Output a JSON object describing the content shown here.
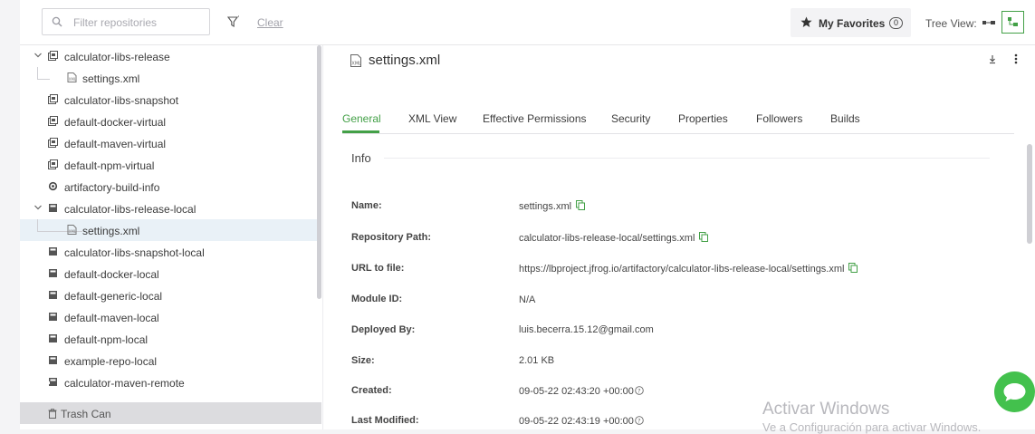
{
  "toolbar": {
    "filter_placeholder": "Filter repositories",
    "clear_label": "Clear",
    "favorites_label": "My Favorites",
    "favorites_count": "0",
    "tree_view_label": "Tree View:"
  },
  "tree": {
    "items": [
      {
        "label": "calculator-libs-release"
      },
      {
        "label": "settings.xml"
      },
      {
        "label": "calculator-libs-snapshot"
      },
      {
        "label": "default-docker-virtual"
      },
      {
        "label": "default-maven-virtual"
      },
      {
        "label": "default-npm-virtual"
      },
      {
        "label": "artifactory-build-info"
      },
      {
        "label": "calculator-libs-release-local"
      },
      {
        "label": "settings.xml"
      },
      {
        "label": "calculator-libs-snapshot-local"
      },
      {
        "label": "default-docker-local"
      },
      {
        "label": "default-generic-local"
      },
      {
        "label": "default-maven-local"
      },
      {
        "label": "default-npm-local"
      },
      {
        "label": "example-repo-local"
      },
      {
        "label": "calculator-maven-remote"
      }
    ],
    "trash_label": "Trash Can"
  },
  "detail": {
    "file_title": "settings.xml",
    "tabs": [
      {
        "label": "General"
      },
      {
        "label": "XML View"
      },
      {
        "label": "Effective Permissions"
      },
      {
        "label": "Security"
      },
      {
        "label": "Properties"
      },
      {
        "label": "Followers"
      },
      {
        "label": "Builds"
      }
    ],
    "active_tab": "General",
    "info_title": "Info",
    "props": [
      {
        "label": "Name:",
        "value": "settings.xml"
      },
      {
        "label": "Repository Path:",
        "value": "calculator-libs-release-local/settings.xml"
      },
      {
        "label": "URL to file:",
        "value": "https://lbproject.jfrog.io/artifactory/calculator-libs-release-local/settings.xml"
      },
      {
        "label": "Module ID:",
        "value": "N/A"
      },
      {
        "label": "Deployed By:",
        "value": "luis.becerra.15.12@gmail.com"
      },
      {
        "label": "Size:",
        "value": "2.01 KB"
      },
      {
        "label": "Created:",
        "value": "09-05-22 02:43:20 +00:00"
      },
      {
        "label": "Last Modified:",
        "value": "09-05-22 02:43:19 +00:00"
      }
    ]
  },
  "watermark": {
    "line1": "Activar Windows",
    "line2": "Ve a Configuración para activar Windows."
  },
  "colors": {
    "accent": "#43a047",
    "chat": "#43c14d",
    "selected_row": "#e9f1f7"
  }
}
